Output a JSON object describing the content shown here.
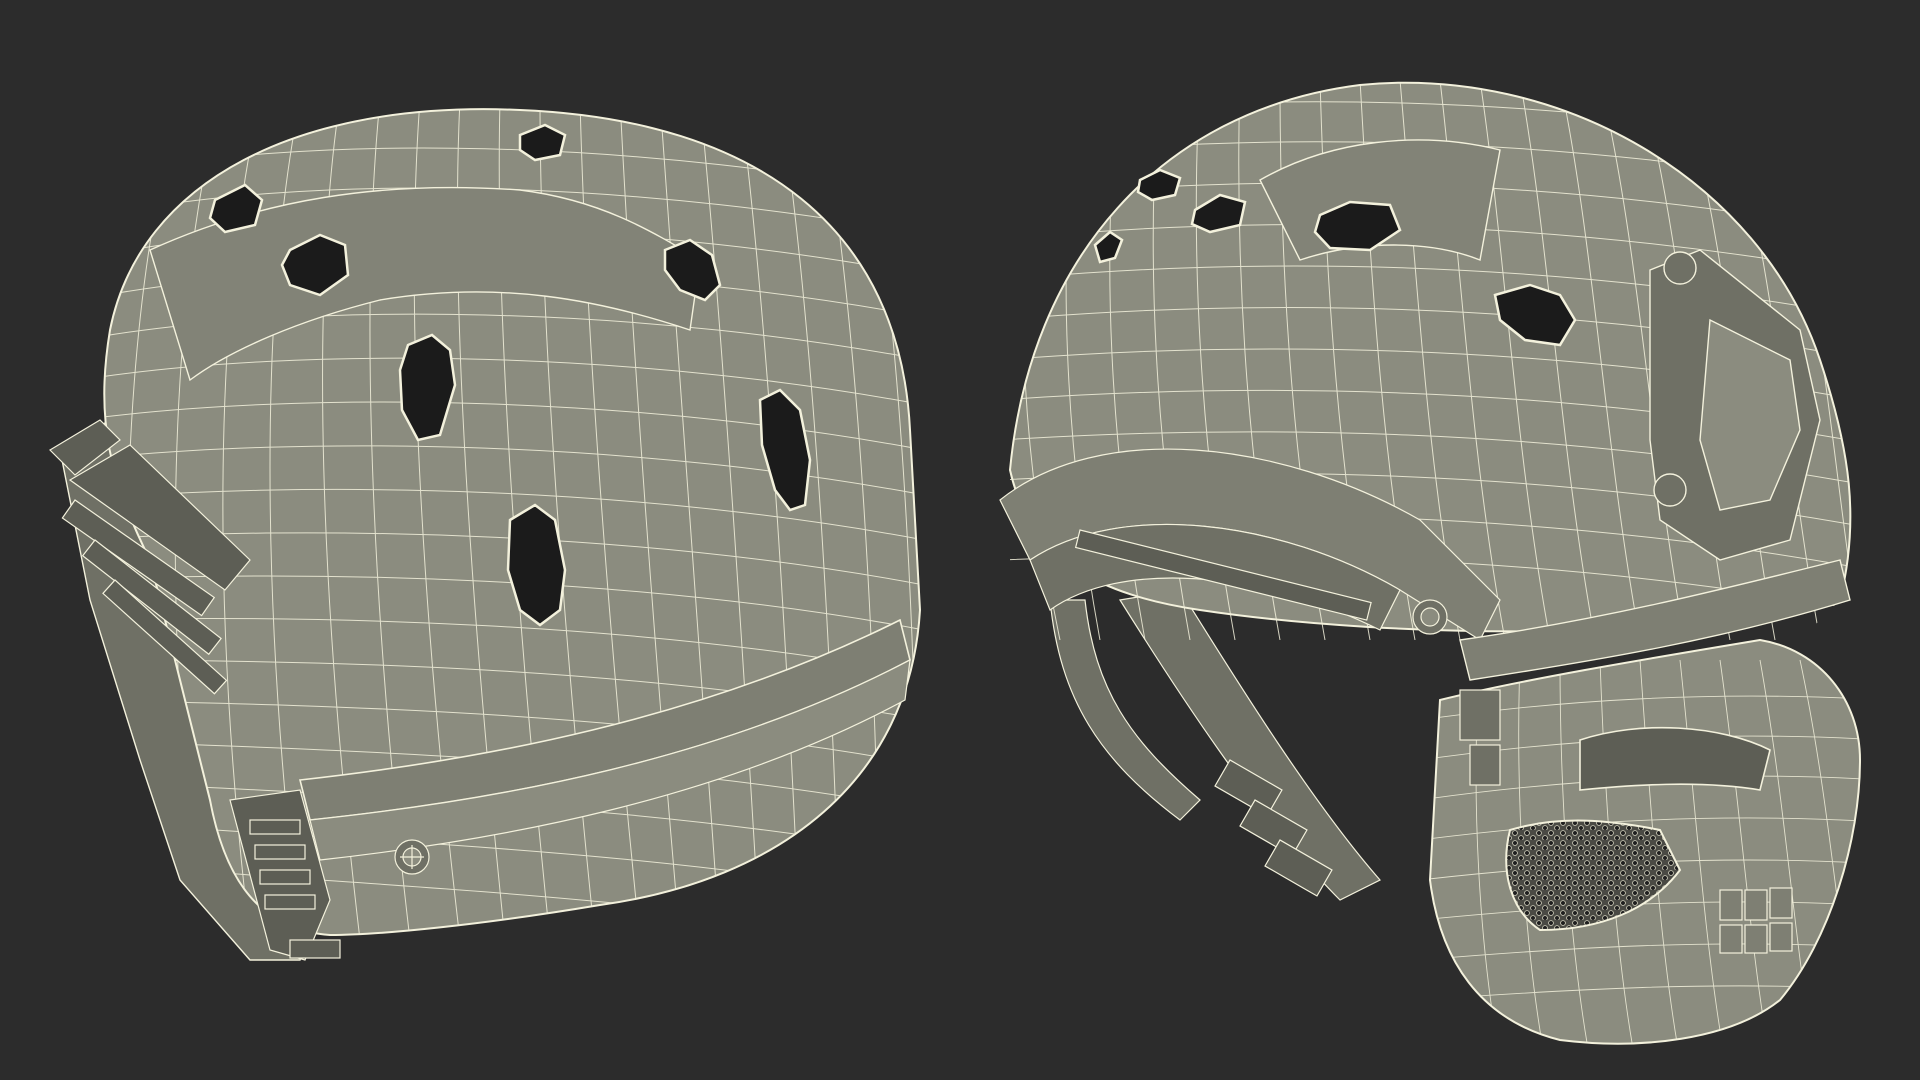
{
  "scene": {
    "background_color": "#2c2c2c",
    "shell_color": "#8b8c7f",
    "shell_dark_color": "#6f7065",
    "wire_color": "#f3f1dc",
    "vent_color": "#1b1b1b",
    "mesh_color": "#b9b8a7"
  },
  "objects": [
    {
      "name": "helmet-rear-view",
      "icon": "helmet-wireframe-icon"
    },
    {
      "name": "helmet-side-view-with-mask",
      "icon": "helmet-mask-wireframe-icon"
    }
  ]
}
